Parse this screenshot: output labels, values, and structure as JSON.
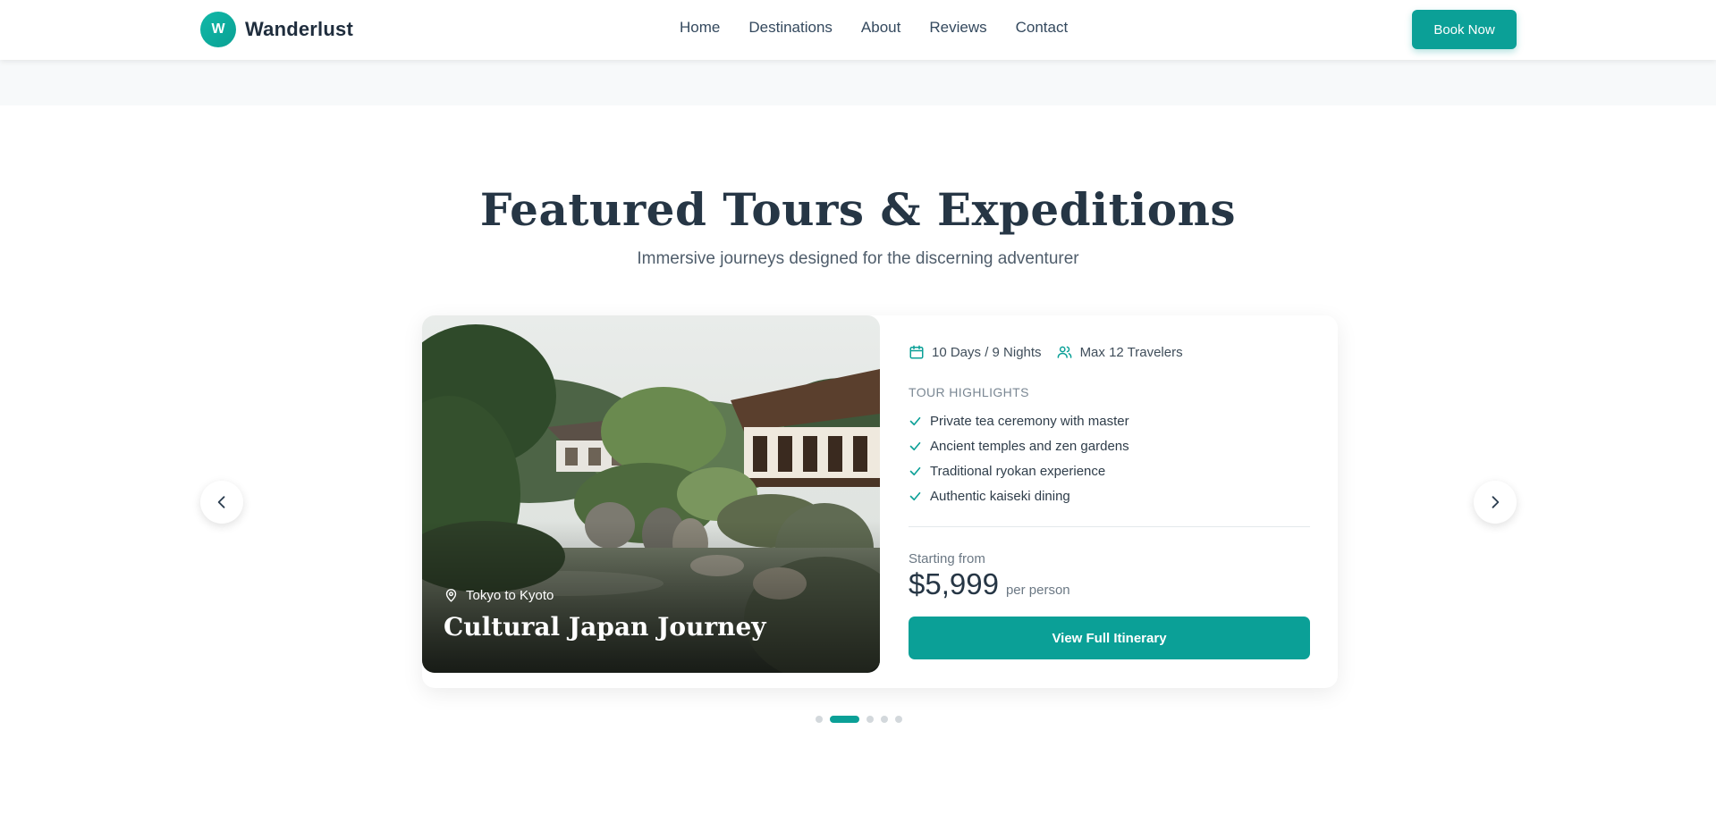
{
  "brand": {
    "initial": "W",
    "name": "Wanderlust"
  },
  "nav": {
    "links": [
      "Home",
      "Destinations",
      "About",
      "Reviews",
      "Contact"
    ],
    "cta": "Book Now"
  },
  "section": {
    "title": "Featured Tours & Expeditions",
    "subtitle": "Immersive journeys designed for the discerning adventurer"
  },
  "tour": {
    "location": "Tokyo to Kyoto",
    "name": "Cultural Japan Journey",
    "duration": "10 Days / 9 Nights",
    "group_size": "Max 12 Travelers",
    "highlights_heading": "TOUR HIGHLIGHTS",
    "highlights": [
      "Private tea ceremony with master",
      "Ancient temples and zen gardens",
      "Traditional ryokan experience",
      "Authentic kaiseki dining"
    ],
    "price_label": "Starting from",
    "price": "$5,999",
    "price_unit": "per person",
    "cta": "View Full Itinerary"
  },
  "carousel": {
    "slide_count": 5,
    "active_index": 1
  },
  "colors": {
    "accent": "#0ba097",
    "heading": "#263645",
    "text": "#2f3d4a"
  },
  "icons": {
    "duration": "calendar-icon",
    "group": "users-icon",
    "location": "map-pin-icon",
    "highlight": "check-icon",
    "prev": "chevron-left-icon",
    "next": "chevron-right-icon"
  }
}
